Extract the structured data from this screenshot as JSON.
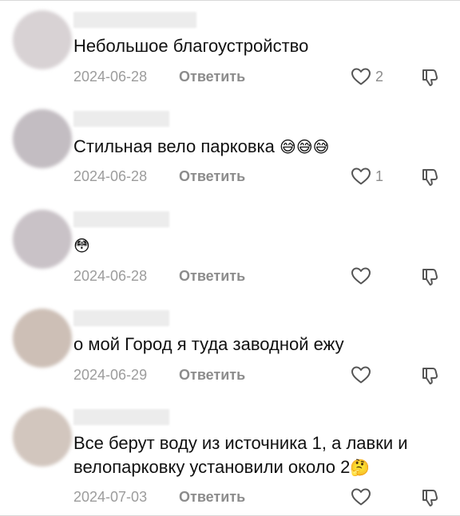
{
  "reply_label": "Ответить",
  "comments": [
    {
      "text": "Небольшое благоустройство",
      "emoji": "",
      "date": "2024-06-28",
      "likes": "2",
      "avatar_color": "#d8d2d4"
    },
    {
      "text": "Стильная вело парковка ",
      "emoji": "😅😅😅",
      "date": "2024-06-28",
      "likes": "1",
      "avatar_color": "#c3bdc2"
    },
    {
      "text": "",
      "emoji": "😳",
      "date": "2024-06-28",
      "likes": "",
      "avatar_color": "#c9c2c7"
    },
    {
      "text": "о мой Город я туда заводной ежу",
      "emoji": "",
      "date": "2024-06-29",
      "likes": "",
      "avatar_color": "#cdbfb6"
    },
    {
      "text": "Все берут воду из источника 1, а лавки и велопарковку установили около 2",
      "emoji": "🤔",
      "date": "2024-07-03",
      "likes": "",
      "avatar_color": "#d2c6be"
    }
  ]
}
